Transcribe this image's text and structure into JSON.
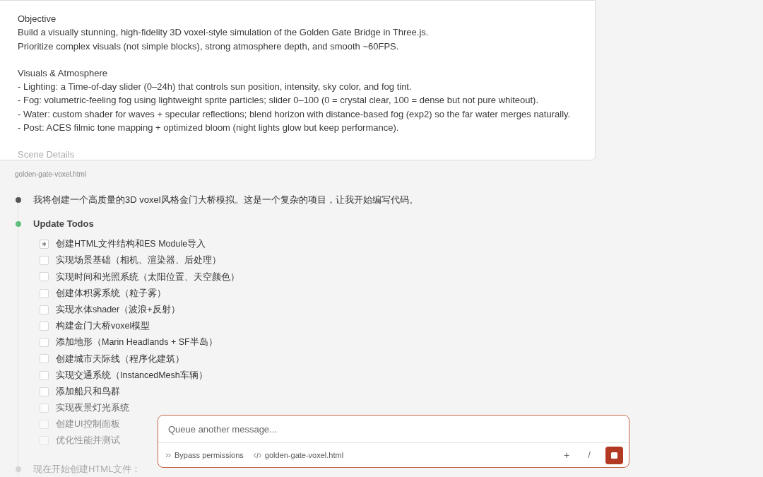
{
  "prompt_card": {
    "lines": [
      {
        "kind": "heading",
        "text": "Objective"
      },
      {
        "kind": "text",
        "text": "Build a visually stunning, high-fidelity 3D voxel-style simulation of the Golden Gate Bridge in Three.js."
      },
      {
        "kind": "text",
        "text": "Prioritize complex visuals (not simple blocks), strong atmosphere depth, and smooth ~60FPS."
      },
      {
        "kind": "blank"
      },
      {
        "kind": "heading",
        "text": "Visuals & Atmosphere"
      },
      {
        "kind": "text",
        "text": "- Lighting: a Time-of-day slider (0–24h) that controls sun position, intensity, sky color, and fog tint."
      },
      {
        "kind": "text",
        "text": "- Fog: volumetric-feeling fog using lightweight sprite particles; slider 0–100 (0 = crystal clear, 100 = dense but not pure whiteout)."
      },
      {
        "kind": "text",
        "text": "- Water: custom shader for waves + specular reflections; blend horizon with distance-based fog (exp2) so the far water merges naturally."
      },
      {
        "kind": "text",
        "text": "- Post: ACES filmic tone mapping + optimized bloom (night lights glow but keep performance)."
      },
      {
        "kind": "blank"
      },
      {
        "kind": "faded",
        "text": "Scene Details"
      }
    ]
  },
  "attachment": "golden-gate-voxel.html",
  "timeline": [
    {
      "kind": "message",
      "color": "#555555",
      "text": "我将创建一个高质量的3D voxel风格金门大桥模拟。这是一个复杂的项目，让我开始编写代码。"
    },
    {
      "kind": "todos",
      "color": "#5fbf7f",
      "title": "Update Todos",
      "todos": [
        {
          "text": "创建HTML文件结构和ES Module导入",
          "in_progress": true
        },
        {
          "text": "实现场景基础（相机、渲染器、后处理）",
          "in_progress": false
        },
        {
          "text": "实现时间和光照系统（太阳位置、天空颜色）",
          "in_progress": false
        },
        {
          "text": "创建体积雾系统（粒子雾）",
          "in_progress": false
        },
        {
          "text": "实现水体shader（波浪+反射）",
          "in_progress": false
        },
        {
          "text": "构建金门大桥voxel模型",
          "in_progress": false
        },
        {
          "text": "添加地形（Marin Headlands + SF半岛）",
          "in_progress": false
        },
        {
          "text": "创建城市天际线（程序化建筑）",
          "in_progress": false
        },
        {
          "text": "实现交通系统（InstancedMesh车辆）",
          "in_progress": false
        },
        {
          "text": "添加船只和鸟群",
          "in_progress": false
        },
        {
          "text": "实现夜景灯光系统",
          "in_progress": false
        },
        {
          "text": "创建UI控制面板",
          "in_progress": false
        },
        {
          "text": "优化性能并测试",
          "in_progress": false
        }
      ]
    },
    {
      "kind": "faded",
      "color": "#d4d4d4",
      "text": "现在开始创建HTML文件："
    }
  ],
  "composer": {
    "placeholder": "Queue another message...",
    "mode": "Bypass permissions",
    "file": "golden-gate-voxel.html",
    "add": "+",
    "slash": "/"
  }
}
